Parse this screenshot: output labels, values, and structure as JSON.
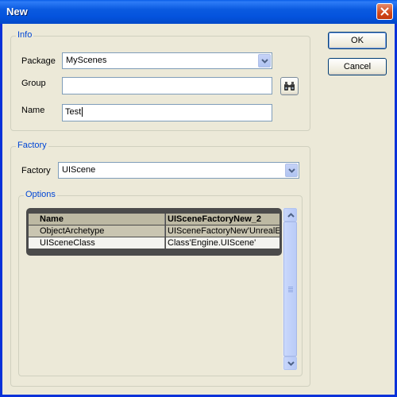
{
  "window": {
    "title": "New"
  },
  "buttons": {
    "ok": "OK",
    "cancel": "Cancel"
  },
  "info": {
    "group_label": "Info",
    "package": {
      "label": "Package",
      "value": "MyScenes"
    },
    "group": {
      "label": "Group",
      "value": ""
    },
    "name": {
      "label": "Name",
      "value": "Test"
    }
  },
  "factory": {
    "group_label": "Factory",
    "factory_field": {
      "label": "Factory",
      "value": "UIScene"
    },
    "options": {
      "group_label": "Options",
      "headers": [
        "Name",
        "UISceneFactoryNew_2"
      ],
      "rows": [
        [
          "ObjectArchetype",
          "UISceneFactoryNew'UnrealEd"
        ],
        [
          "UISceneClass",
          "Class'Engine.UIScene'"
        ]
      ]
    }
  },
  "icons": {
    "close": "close-icon",
    "browse": "binoculars-icon",
    "dropdown": "chevron-down-icon",
    "scroll_up": "arrow-up-icon",
    "scroll_down": "arrow-down-icon"
  }
}
